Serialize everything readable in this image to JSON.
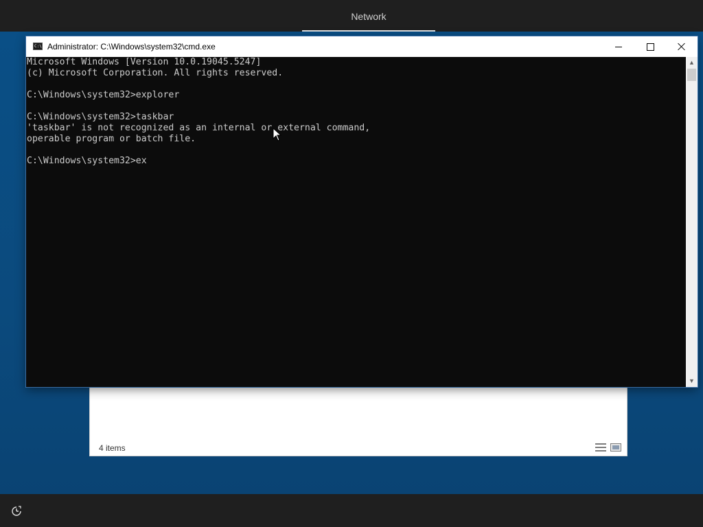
{
  "top_bar": {
    "tab_label": "Network"
  },
  "cmd_window": {
    "title": "Administrator: C:\\Windows\\system32\\cmd.exe",
    "console_lines": [
      "Microsoft Windows [Version 10.0.19045.5247]",
      "(c) Microsoft Corporation. All rights reserved.",
      "",
      "C:\\Windows\\system32>explorer",
      "",
      "C:\\Windows\\system32>taskbar",
      "'taskbar' is not recognized as an internal or external command,",
      "operable program or batch file.",
      "",
      "C:\\Windows\\system32>ex"
    ]
  },
  "explorer_panel": {
    "status_text": "4 items"
  },
  "colors": {
    "desktop": "#0b4a7d",
    "console_bg": "#0c0c0c",
    "console_text": "#cccccc",
    "top_bar": "#1f1f1f"
  },
  "icons": {
    "cmd_app": "cmd-app-icon",
    "minimize": "minimize-icon",
    "maximize": "maximize-icon",
    "close": "close-icon",
    "ease_of_access": "ease-of-access-icon"
  }
}
